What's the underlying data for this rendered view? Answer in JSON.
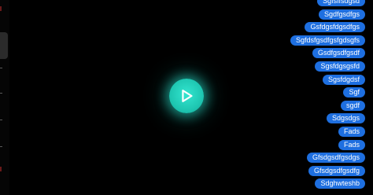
{
  "player": {
    "play_icon": "play-icon",
    "accent_color": "#22d3be"
  },
  "messages": [
    "Sgfsffsdgsd",
    "Sgdfgsdfgs",
    "Gsfdgsfdgsdfgs",
    "Sgfdsfgsdfgsfgdsgfs",
    "Gsdfgsdfgsdf",
    "Sgsfdgsgsfd",
    "Sgsfdgdsf",
    "Sgf",
    "sgdf",
    "Sdgsdgs",
    "Fads",
    "Fads",
    "Gfsdgsdfgsdgs",
    "Gfsdgsdfgsdfg",
    "Sdghwteshb"
  ],
  "colors": {
    "background": "#000000",
    "bubble": "#1e6fe0",
    "bubble_text": "#ffffff"
  }
}
